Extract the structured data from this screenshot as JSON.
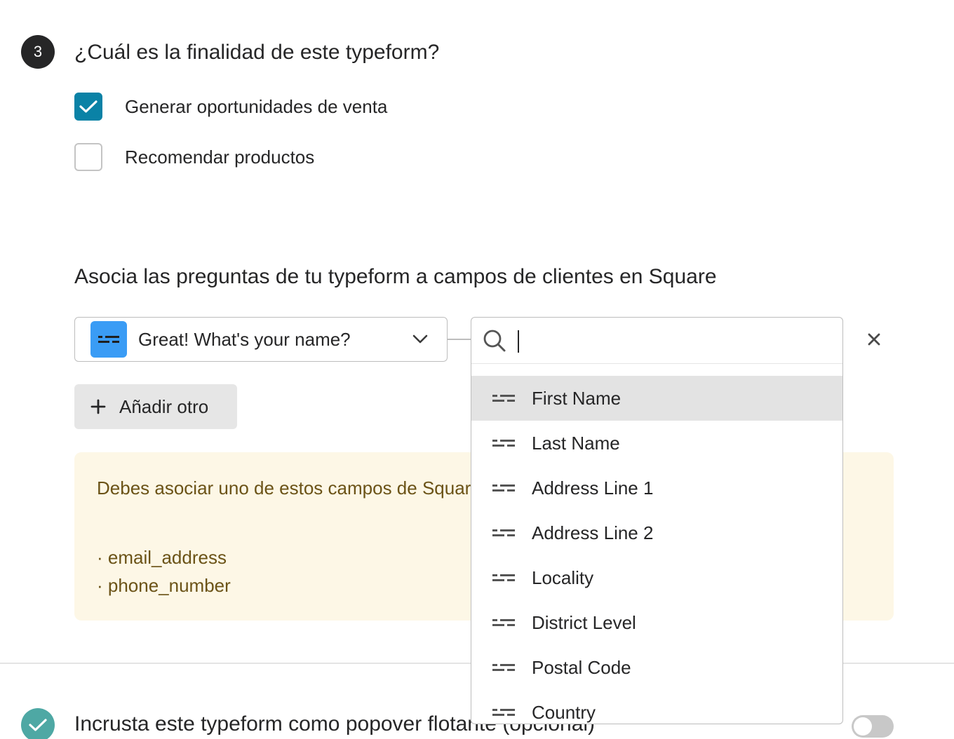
{
  "question": {
    "number": "3",
    "title": "¿Cuál es la finalidad de este typeform?",
    "options": [
      {
        "label": "Generar oportunidades de venta",
        "checked": true
      },
      {
        "label": "Recomendar productos",
        "checked": false
      }
    ]
  },
  "mapping": {
    "title": "Asocia las preguntas de tu typeform a campos de clientes en Square",
    "selected_question": "Great! What's your name?",
    "add_label": "Añadir otro",
    "search": {
      "placeholder": "",
      "value": ""
    },
    "fields": [
      "First Name",
      "Last Name",
      "Address Line 1",
      "Address Line 2",
      "Locality",
      "District Level",
      "Postal Code",
      "Country"
    ],
    "highlighted_field_index": 0
  },
  "warning": {
    "text": "Debes asociar uno de estos campos de Square",
    "items": [
      "· email_address",
      "· phone_number"
    ]
  },
  "embed": {
    "title": "Incrusta este typeform como popover flotante (opcional)",
    "enabled": false
  },
  "colors": {
    "accent": "#0a82a6",
    "field_icon": "#3a9cf5",
    "warning_bg": "#fdf7e6",
    "warning_text": "#6b5317",
    "done_badge": "#4ea8a4"
  }
}
